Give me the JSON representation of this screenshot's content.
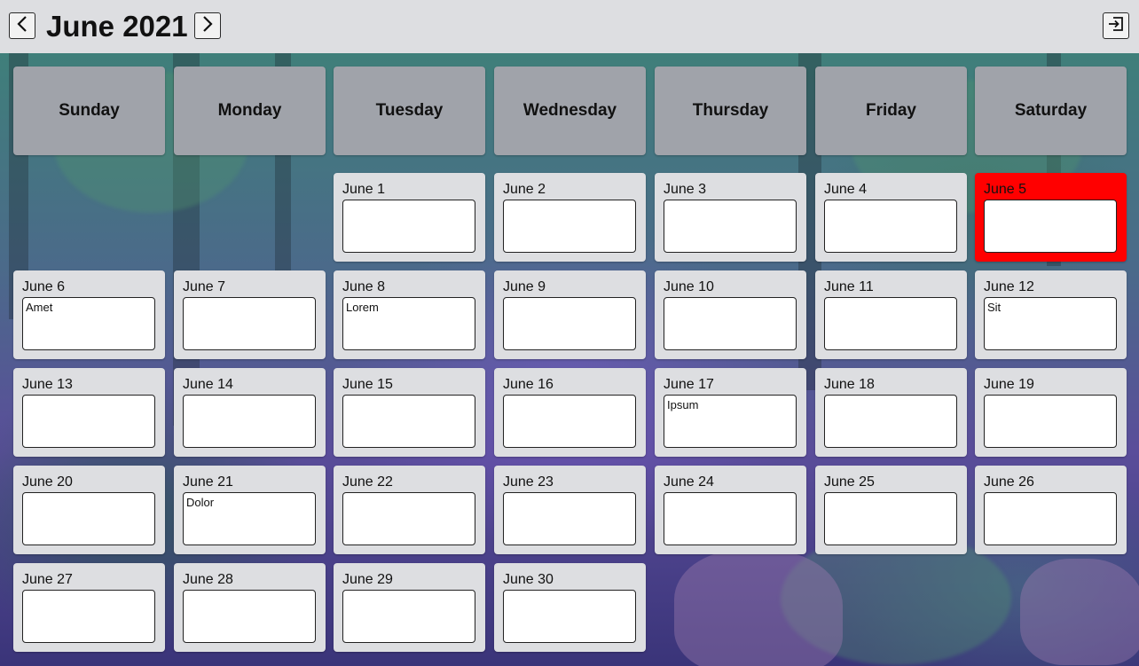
{
  "header": {
    "title": "June 2021",
    "prev_icon": "chevron-left-icon",
    "next_icon": "chevron-right-icon",
    "exit_icon": "logout-icon"
  },
  "weekdays": [
    "Sunday",
    "Monday",
    "Tuesday",
    "Wednesday",
    "Thursday",
    "Friday",
    "Saturday"
  ],
  "days": [
    {
      "label": "June 1",
      "note": ""
    },
    {
      "label": "June 2",
      "note": ""
    },
    {
      "label": "June 3",
      "note": ""
    },
    {
      "label": "June 4",
      "note": ""
    },
    {
      "label": "June 5",
      "note": "",
      "today": true
    },
    {
      "label": "June 6",
      "note": "Amet"
    },
    {
      "label": "June 7",
      "note": ""
    },
    {
      "label": "June 8",
      "note": "Lorem"
    },
    {
      "label": "June 9",
      "note": ""
    },
    {
      "label": "June 10",
      "note": ""
    },
    {
      "label": "June 11",
      "note": ""
    },
    {
      "label": "June 12",
      "note": "Sit"
    },
    {
      "label": "June 13",
      "note": ""
    },
    {
      "label": "June 14",
      "note": ""
    },
    {
      "label": "June 15",
      "note": ""
    },
    {
      "label": "June 16",
      "note": ""
    },
    {
      "label": "June 17",
      "note": "Ipsum"
    },
    {
      "label": "June 18",
      "note": ""
    },
    {
      "label": "June 19",
      "note": ""
    },
    {
      "label": "June 20",
      "note": ""
    },
    {
      "label": "June 21",
      "note": "Dolor"
    },
    {
      "label": "June 22",
      "note": ""
    },
    {
      "label": "June 23",
      "note": ""
    },
    {
      "label": "June 24",
      "note": ""
    },
    {
      "label": "June 25",
      "note": ""
    },
    {
      "label": "June 26",
      "note": ""
    },
    {
      "label": "June 27",
      "note": ""
    },
    {
      "label": "June 28",
      "note": ""
    },
    {
      "label": "June 29",
      "note": ""
    },
    {
      "label": "June 30",
      "note": ""
    }
  ],
  "colors": {
    "today": "#ff0000",
    "cell": "#dddee1",
    "header_cell": "#a0a3aa"
  }
}
